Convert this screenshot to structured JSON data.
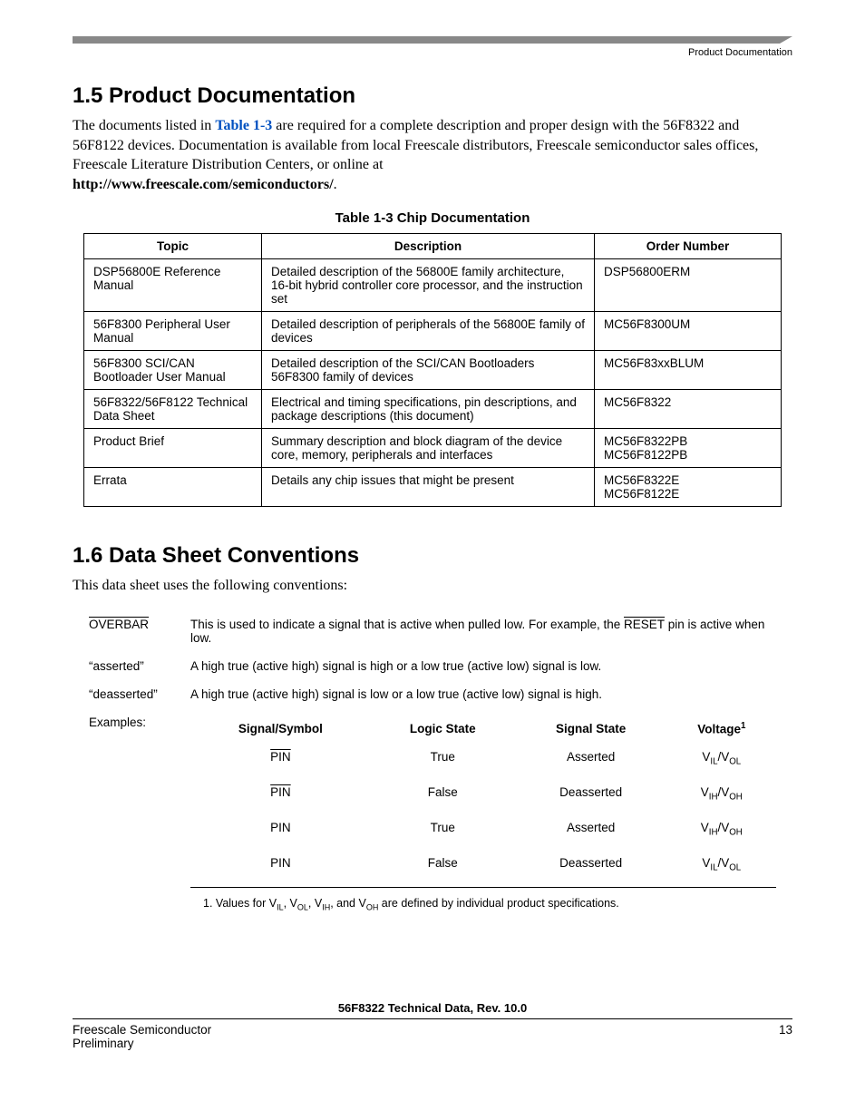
{
  "header": {
    "label": "Product Documentation"
  },
  "section15": {
    "heading": "1.5   Product Documentation",
    "para_pre": "The documents listed in ",
    "para_link": "Table 1-3",
    "para_post": " are required for a complete description and proper design with the 56F8322 and 56F8122 devices. Documentation is available from local Freescale distributors, Freescale semiconductor sales offices, Freescale Literature Distribution Centers, or online at ",
    "url": "http://www.freescale.com/semiconductors/",
    "dot": "."
  },
  "table13": {
    "caption": "Table 1-3 Chip Documentation",
    "headers": [
      "Topic",
      "Description",
      "Order Number"
    ],
    "rows": [
      {
        "topic": "DSP56800E Reference Manual",
        "desc": "Detailed description of the 56800E family architecture, 16-bit hybrid controller core processor, and the instruction set",
        "order": "DSP56800ERM"
      },
      {
        "topic": "56F8300 Peripheral User Manual",
        "desc": "Detailed description of peripherals of the 56800E family of devices",
        "order": "MC56F8300UM"
      },
      {
        "topic": "56F8300 SCI/CAN Bootloader User Manual",
        "desc": "Detailed description of the SCI/CAN Bootloaders 56F8300 family of devices",
        "order": "MC56F83xxBLUM"
      },
      {
        "topic": "56F8322/56F8122 Technical Data Sheet",
        "desc": "Electrical and timing specifications, pin descriptions, and package descriptions (this document)",
        "order": "MC56F8322"
      },
      {
        "topic": "Product Brief",
        "desc": "Summary description and block diagram of the device core, memory, peripherals and interfaces",
        "order": "MC56F8322PB MC56F8122PB"
      },
      {
        "topic": "Errata",
        "desc": "Details any chip issues that might be present",
        "order": "MC56F8322E MC56F8122E"
      }
    ]
  },
  "section16": {
    "heading": "1.6   Data Sheet Conventions",
    "intro": "This data sheet uses the following conventions:"
  },
  "conventions": {
    "overbar_term": "OVERBAR",
    "overbar_desc_pre": "This is used to indicate a signal that is active when pulled low. For example, the ",
    "overbar_desc_sig": "RESET",
    "overbar_desc_post": " pin is active when low.",
    "asserted_term": "“asserted”",
    "asserted_desc": "A high true (active high) signal is high or a low true (active low) signal is low.",
    "deasserted_term": "“deasserted”",
    "deasserted_desc": "A high true (active high) signal is low or a low true (active low) signal is high.",
    "examples_label": "Examples:",
    "ex_headers": {
      "signal": "Signal/Symbol",
      "logic": "Logic State",
      "state": "Signal State",
      "voltage": "Voltage",
      "voltage_sup": "1"
    },
    "ex_rows": [
      {
        "sig": "PIN",
        "sig_over": true,
        "logic": "True",
        "state": "Asserted",
        "v": "V_IL/V_OL"
      },
      {
        "sig": "PIN",
        "sig_over": true,
        "logic": "False",
        "state": "Deasserted",
        "v": "V_IH/V_OH"
      },
      {
        "sig": "PIN",
        "sig_over": false,
        "logic": "True",
        "state": "Asserted",
        "v": "V_IH/V_OH"
      },
      {
        "sig": "PIN",
        "sig_over": false,
        "logic": "False",
        "state": "Deasserted",
        "v": "V_IL/V_OL"
      }
    ],
    "footnote_num": "1.  ",
    "footnote_pre": "Values for V",
    "footnote_rest": " are defined by individual product specifications."
  },
  "footer": {
    "title": "56F8322 Technical Data, Rev. 10.0",
    "left1": "Freescale Semiconductor",
    "left2": "Preliminary",
    "right": "13"
  }
}
